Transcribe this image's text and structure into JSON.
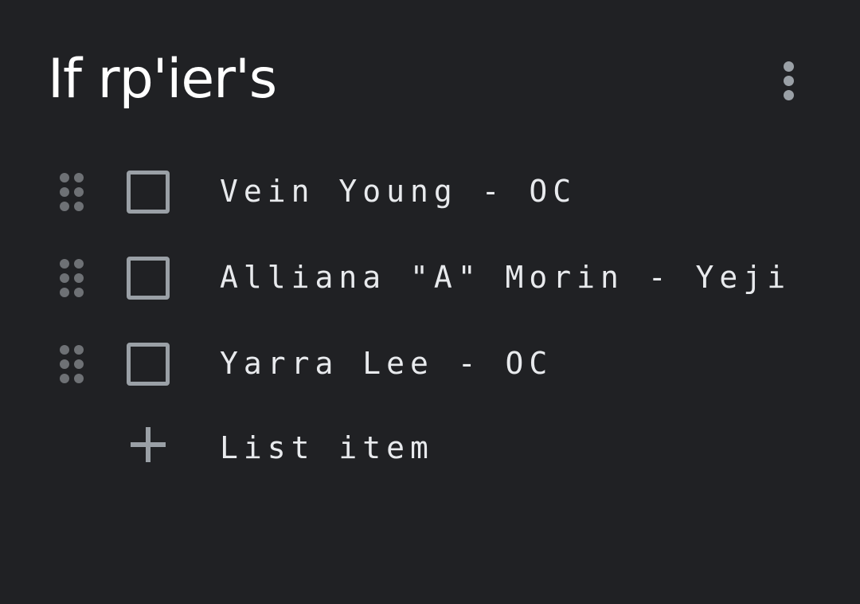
{
  "note": {
    "title": "If rp'ier's",
    "more_icon": "more-vert-icon",
    "items": [
      {
        "label": "Vein Young - OC",
        "checked": false
      },
      {
        "label": "Alliana \"A\" Morin - Yeji",
        "checked": false
      },
      {
        "label": "Yarra Lee - OC",
        "checked": false
      }
    ],
    "add_item": {
      "label": "List item",
      "icon": "plus-icon"
    }
  },
  "colors": {
    "background": "#202124",
    "text": "#e8eaed",
    "icon": "#9aa0a6",
    "drag_handle": "#6e7175"
  }
}
